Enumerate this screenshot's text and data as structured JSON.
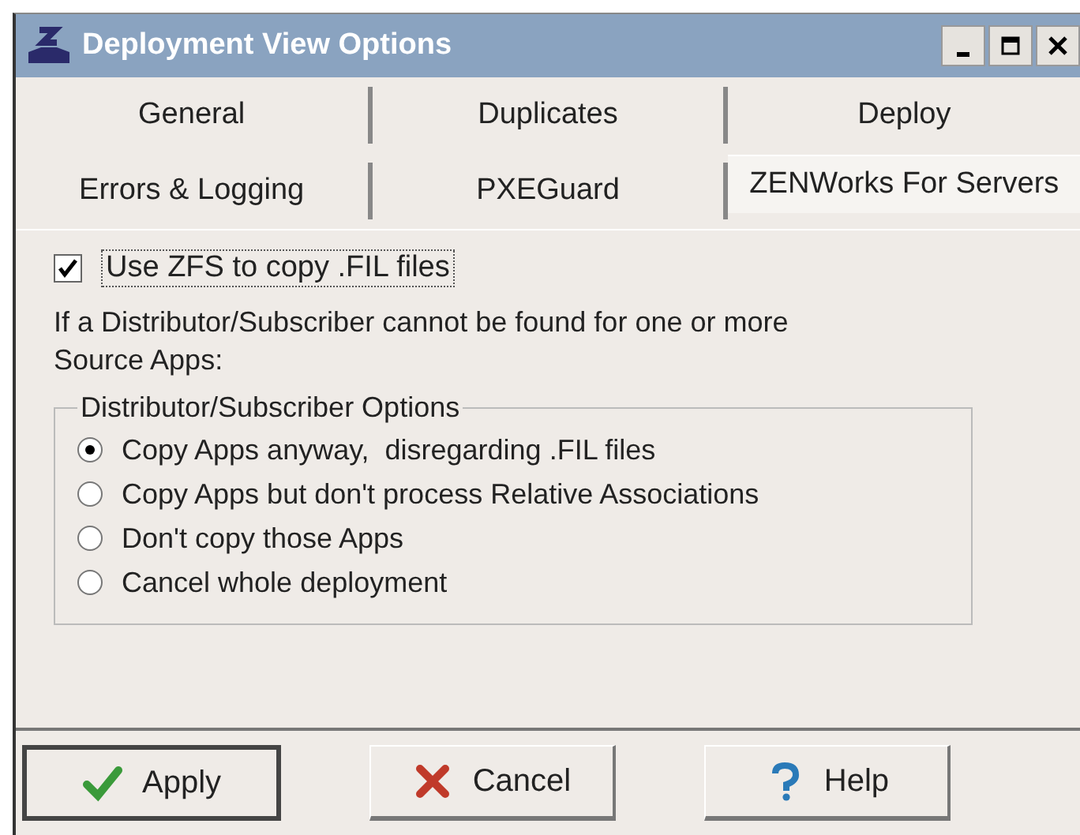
{
  "window": {
    "title": "Deployment View Options"
  },
  "tab_rows": [
    [
      {
        "label": "General",
        "selected": false
      },
      {
        "label": "Duplicates",
        "selected": false
      },
      {
        "label": "Deploy",
        "selected": false
      }
    ],
    [
      {
        "label": "Errors & Logging",
        "selected": false
      },
      {
        "label": "PXEGuard",
        "selected": false
      },
      {
        "label": "ZENWorks For Servers",
        "selected": true
      }
    ]
  ],
  "use_zfs": {
    "label": "Use ZFS to copy .FIL files",
    "checked": true
  },
  "description": "If a Distributor/Subscriber cannot be found for one or more Source Apps:",
  "group": {
    "title": "Distributor/Subscriber Options",
    "options": [
      {
        "label": "Copy Apps anyway,  disregarding .FIL files",
        "selected": true
      },
      {
        "label": "Copy Apps but don't process Relative Associations",
        "selected": false
      },
      {
        "label": "Don't copy those Apps",
        "selected": false
      },
      {
        "label": "Cancel whole deployment",
        "selected": false
      }
    ]
  },
  "buttons": [
    {
      "label": "Apply",
      "kind": "apply",
      "default": true
    },
    {
      "label": "Cancel",
      "kind": "cancel",
      "default": false
    },
    {
      "label": "Help",
      "kind": "help",
      "default": false
    }
  ]
}
